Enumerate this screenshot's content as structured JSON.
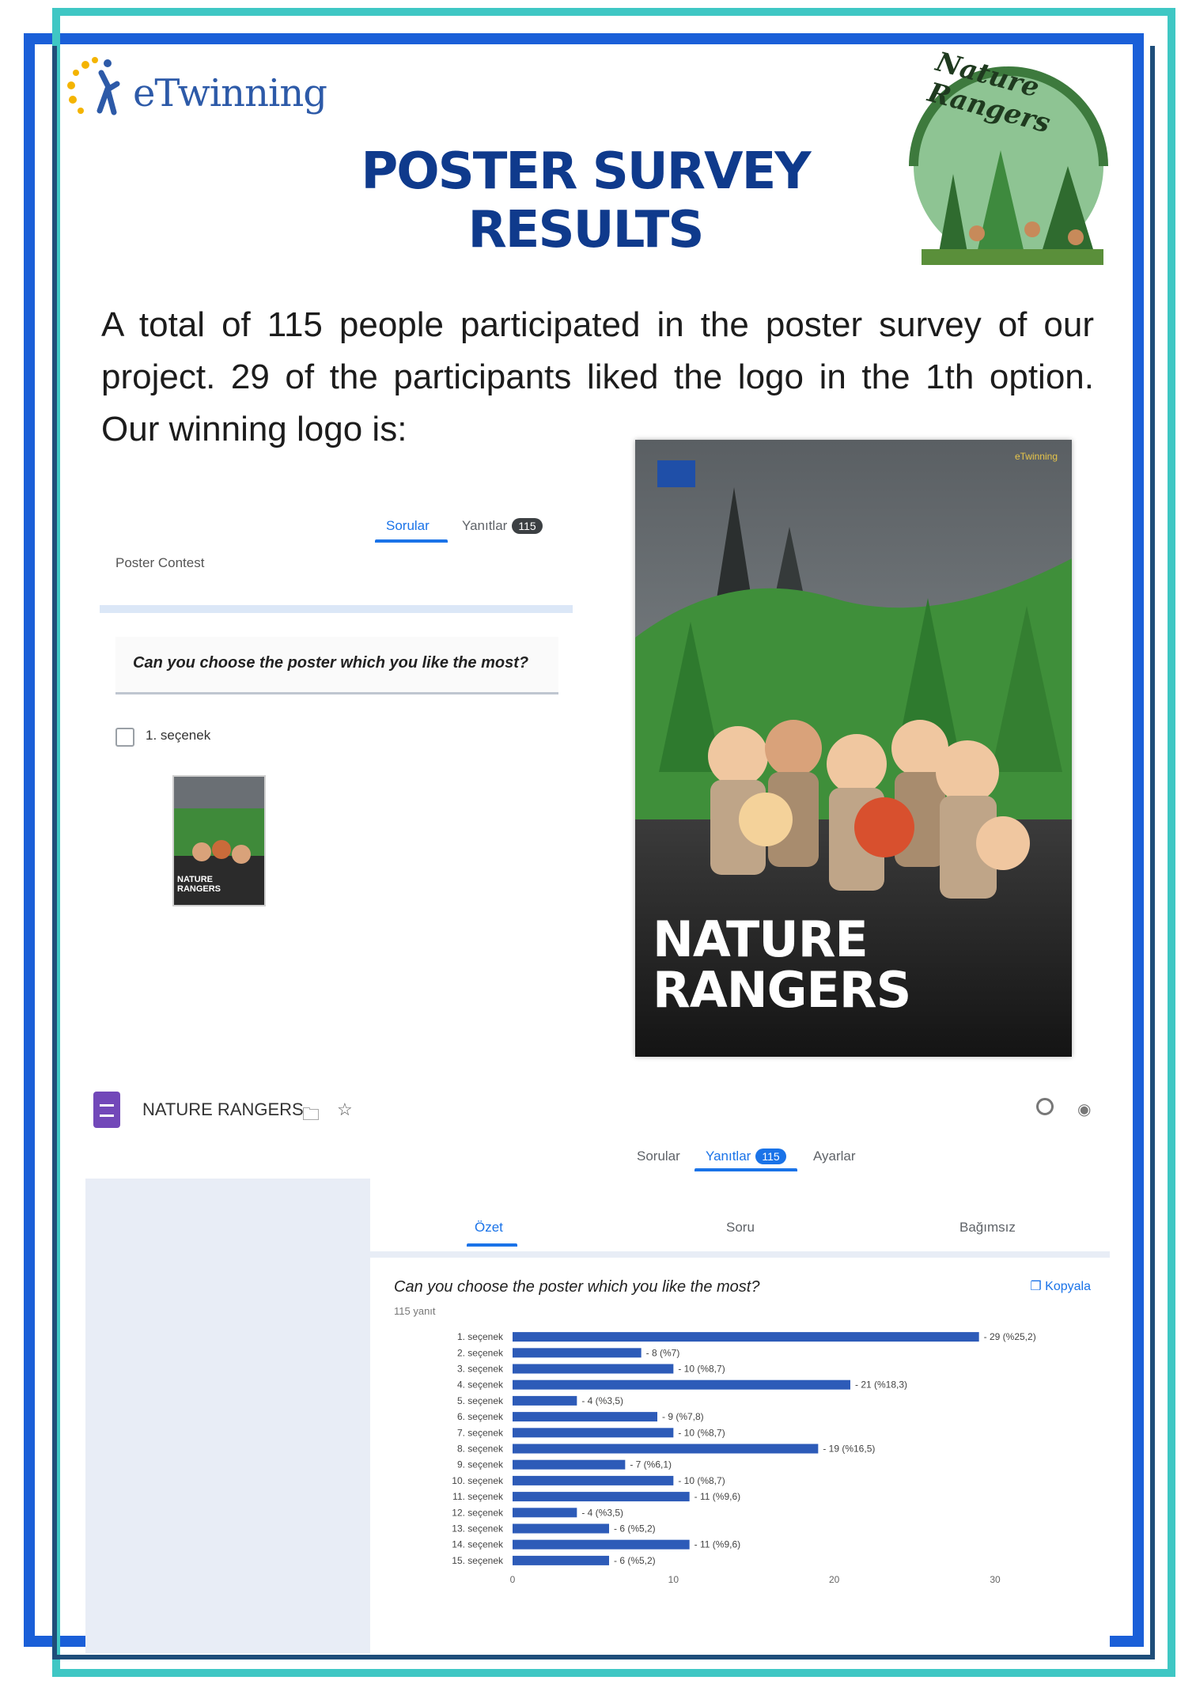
{
  "header": {
    "etwinning_logo_text": "eTwinning",
    "title": "POSTER SURVEY RESULTS",
    "badge_text": "Nature Rangers"
  },
  "intro": {
    "text": "A total of 115 people participated in the poster survey of our project. 29 of the participants liked the logo in the 1th option. Our winning logo is:"
  },
  "form_snapshot": {
    "tabs": [
      {
        "label": "Sorular",
        "active": true
      },
      {
        "label": "Yanıtlar",
        "count": "115",
        "active": false
      }
    ],
    "form_title": "Poster Contest",
    "question": "Can you choose the poster which you like the most?",
    "option_label": "1. seçenek",
    "thumb_caption": "NATURE RANGERS"
  },
  "poster": {
    "title_line1": "NATURE",
    "title_line2": "RANGERS",
    "brand": "eTwinning"
  },
  "forms_bar": {
    "doc_title": "NATURE RANGERS",
    "tabs": [
      {
        "label": "Sorular",
        "active": false
      },
      {
        "label": "Yanıtlar",
        "count": "115",
        "active": true
      },
      {
        "label": "Ayarlar",
        "active": false
      }
    ],
    "subtabs": [
      {
        "label": "Özet",
        "active": true
      },
      {
        "label": "Soru",
        "active": false
      },
      {
        "label": "Bağımsız",
        "active": false
      }
    ]
  },
  "chart_card": {
    "question": "Can you choose the poster which you like the most?",
    "response_count": "115 yanıt",
    "copy_label": "Kopyala"
  },
  "chart_data": {
    "type": "bar",
    "orientation": "horizontal",
    "categories": [
      "1. seçenek",
      "2. seçenek",
      "3. seçenek",
      "4. seçenek",
      "5. seçenek",
      "6. seçenek",
      "7. seçenek",
      "8. seçenek",
      "9. seçenek",
      "10. seçenek",
      "11. seçenek",
      "12. seçenek",
      "13. seçenek",
      "14. seçenek",
      "15. seçenek"
    ],
    "values": [
      29,
      8,
      10,
      21,
      4,
      9,
      10,
      19,
      7,
      10,
      11,
      4,
      6,
      11,
      6
    ],
    "value_labels": [
      "29 (%25,2)",
      "8 (%7)",
      "10 (%8,7)",
      "21 (%18,3)",
      "4 (%3,5)",
      "9 (%7,8)",
      "10 (%8,7)",
      "19 (%16,5)",
      "7 (%6,1)",
      "10 (%8,7)",
      "11 (%9,6)",
      "4 (%3,5)",
      "6 (%5,2)",
      "11 (%9,6)",
      "6 (%5,2)"
    ],
    "xticks": [
      "0",
      "10",
      "20",
      "30"
    ],
    "xlim": [
      0,
      30
    ],
    "bar_color": "#2d5bb8"
  }
}
